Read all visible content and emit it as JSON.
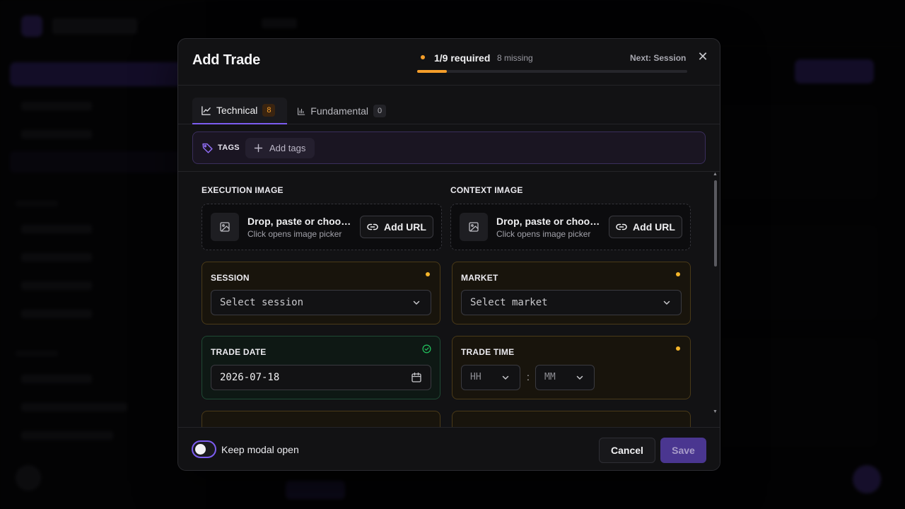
{
  "modal": {
    "title": "Add Trade",
    "progress": {
      "required_text": "1/9 required",
      "missing_text": "8 missing",
      "fraction": 0.111,
      "next_text": "Next: Session",
      "color": "#f59e2a"
    },
    "close_symbol": "✕"
  },
  "tabs": [
    {
      "label": "Technical",
      "count": "8",
      "icon": "line-chart-icon",
      "active": true
    },
    {
      "label": "Fundamental",
      "count": "0",
      "icon": "bar-chart-icon",
      "active": false
    }
  ],
  "tags": {
    "label": "TAGS",
    "add_label": "Add tags",
    "icon": "tag-icon"
  },
  "images": [
    {
      "label": "EXECUTION IMAGE",
      "drop_title": "Drop, paste or choose an image",
      "drop_sub": "Click opens image picker",
      "url_button": "Add URL"
    },
    {
      "label": "CONTEXT IMAGE",
      "drop_title": "Drop, paste or choose an image",
      "drop_sub": "Click opens image picker",
      "url_button": "Add URL"
    }
  ],
  "fields": {
    "session": {
      "label": "SESSION",
      "placeholder": "Select session",
      "status": "required"
    },
    "market": {
      "label": "MARKET",
      "placeholder": "Select market",
      "status": "required"
    },
    "trade_date": {
      "label": "TRADE DATE",
      "value": "2026-07-18",
      "status": "complete"
    },
    "trade_time": {
      "label": "TRADE TIME",
      "hour_placeholder": "HH",
      "minute_placeholder": "MM",
      "separator": ":",
      "status": "required"
    }
  },
  "footer": {
    "keep_open_label": "Keep modal open",
    "keep_open": false,
    "cancel_label": "Cancel",
    "save_label": "Save"
  },
  "colors": {
    "accent": "#7c5cf0",
    "warning": "#f5b52a",
    "success": "#22c55e",
    "save_button": "#4a3690"
  }
}
